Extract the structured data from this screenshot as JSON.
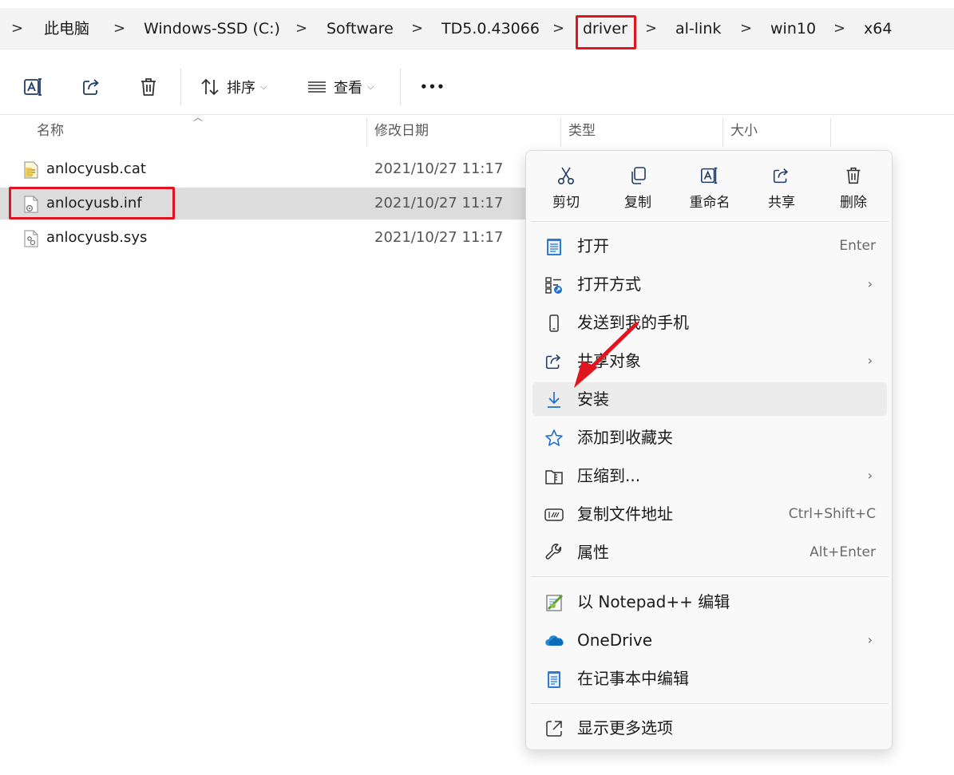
{
  "breadcrumb": {
    "items": [
      "此电脑",
      "Windows-SSD (C:)",
      "Software",
      "TD5.0.43066",
      "driver",
      "al-link",
      "win10",
      "x64"
    ],
    "separator": ">"
  },
  "toolbar": {
    "sort_label": "排序",
    "view_label": "查看",
    "more_label": "•••",
    "icons": [
      "rename-icon",
      "share-icon",
      "delete-icon",
      "sort-icon",
      "view-icon",
      "more-icon"
    ]
  },
  "columns": {
    "name": "名称",
    "date": "修改日期",
    "type": "类型",
    "size": "大小"
  },
  "files": [
    {
      "name": "anlocyusb.cat",
      "date": "2021/10/27 11:17",
      "icon": "catalog-file-icon"
    },
    {
      "name": "anlocyusb.inf",
      "date": "2021/10/27 11:17",
      "icon": "setup-info-file-icon",
      "selected": true
    },
    {
      "name": "anlocyusb.sys",
      "date": "2021/10/27 11:17",
      "icon": "system-file-icon"
    }
  ],
  "context_menu": {
    "quick_actions": [
      {
        "label": "剪切",
        "icon": "cut-icon"
      },
      {
        "label": "复制",
        "icon": "copy-icon"
      },
      {
        "label": "重命名",
        "icon": "rename-icon"
      },
      {
        "label": "共享",
        "icon": "share-icon"
      },
      {
        "label": "删除",
        "icon": "delete-icon"
      }
    ],
    "items": [
      {
        "label": "打开",
        "shortcut": "Enter",
        "icon": "notepad-open-icon"
      },
      {
        "label": "打开方式",
        "submenu": true,
        "icon": "open-with-icon"
      },
      {
        "label": "发送到我的手机",
        "icon": "phone-icon"
      },
      {
        "label": "共享对象",
        "submenu": true,
        "icon": "share-icon"
      },
      {
        "label": "安装",
        "icon": "install-download-icon",
        "hovered": true
      },
      {
        "label": "添加到收藏夹",
        "icon": "star-icon"
      },
      {
        "label": "压缩到...",
        "submenu": true,
        "icon": "archive-icon"
      },
      {
        "label": "复制文件地址",
        "shortcut": "Ctrl+Shift+C",
        "icon": "copy-path-icon"
      },
      {
        "label": "属性",
        "shortcut": "Alt+Enter",
        "icon": "wrench-icon"
      }
    ],
    "extra_items": [
      {
        "label": "以 Notepad++ 编辑",
        "icon": "notepadpp-icon"
      },
      {
        "label": "OneDrive",
        "submenu": true,
        "icon": "onedrive-cloud-icon"
      },
      {
        "label": "在记事本中编辑",
        "icon": "notepad-icon"
      }
    ],
    "more_item": {
      "label": "显示更多选项",
      "icon": "show-more-icon"
    }
  },
  "colors": {
    "accent": "#005fb8",
    "highlight_box": "#e0141e",
    "selected_row": "#dcdcdc",
    "menu_hover": "#ececec"
  }
}
